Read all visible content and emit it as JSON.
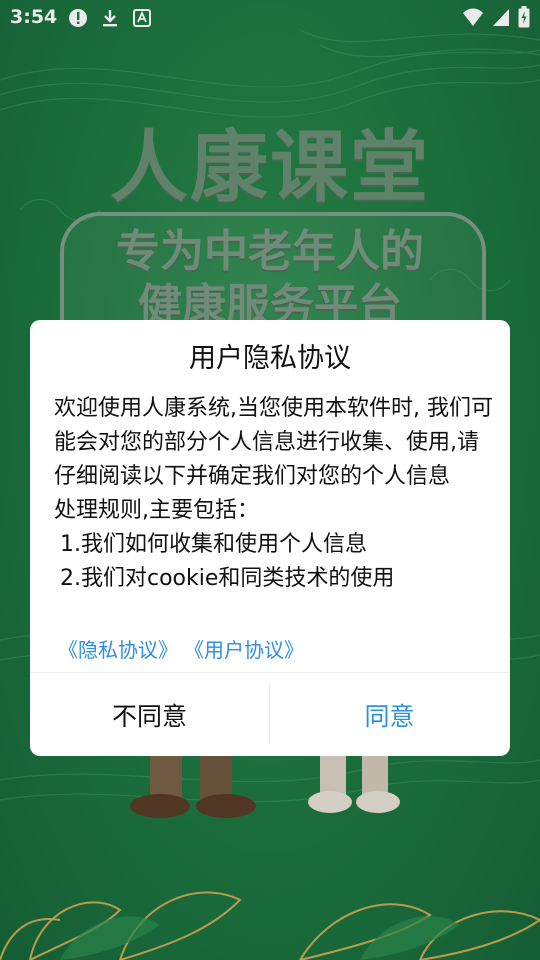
{
  "status_bar": {
    "time": "3:54",
    "left_icons": [
      "alert-icon",
      "download-icon",
      "keyboard-a-icon"
    ],
    "right_icons": [
      "wifi-icon",
      "signal-icon",
      "battery-icon"
    ]
  },
  "background": {
    "app_title": "人康课堂",
    "slogan_line1": "专为中老年人的",
    "slogan_line2": "健康服务平台"
  },
  "dialog": {
    "title": "用户隐私协议",
    "body": {
      "paragraph": "欢迎使用人康系统,当您使用本软件时, 我们可能会对您的部分个人信息进行收集、使用,请仔细阅读以下并确定我们对您的个人信息",
      "intro": "处理规则,主要包括：",
      "items": [
        "1.我们如何收集和使用个人信息",
        "2.我们对cookie和同类技术的使用"
      ]
    },
    "links": {
      "privacy": "《隐私协议》",
      "user": "《用户协议》"
    },
    "buttons": {
      "disagree": "不同意",
      "agree": "同意"
    }
  },
  "colors": {
    "background_green": "#1f7a42",
    "link_blue": "#2f8fe0",
    "dialog_white": "#ffffff"
  }
}
